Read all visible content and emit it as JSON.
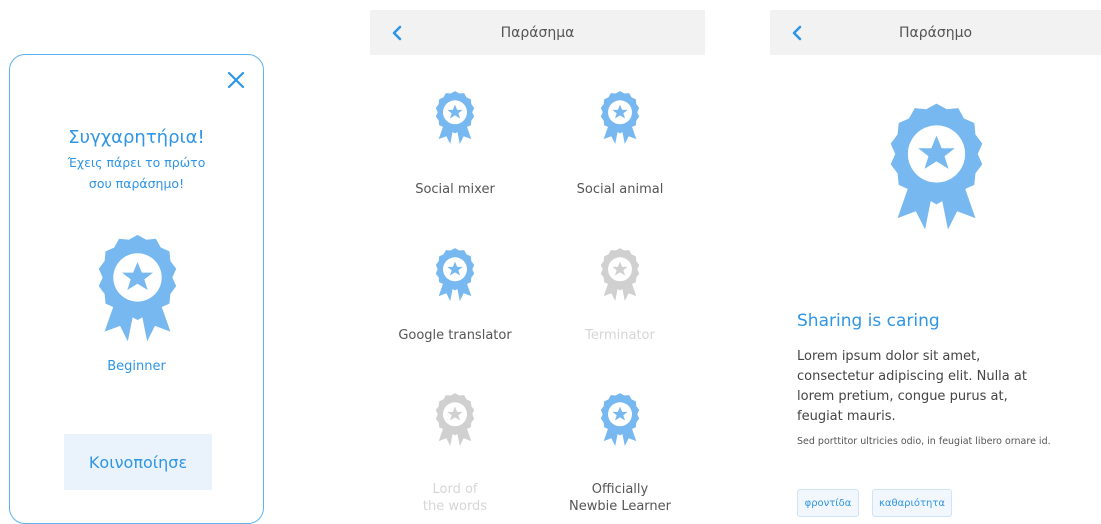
{
  "colors": {
    "accent": "#2f95e5",
    "badge": "#76b8ef",
    "badge_disabled": "#d0d0d0"
  },
  "modal": {
    "close_icon": "close-icon",
    "title": "Συγχαρητήρια!",
    "subtitle_line1": "Έχεις πάρει το πρώτο",
    "subtitle_line2": "σου παράσημο!",
    "badge_label": "Beginner",
    "share_label": "Κοινοποίησε"
  },
  "list": {
    "header_title": "Παράσημα",
    "badges": [
      {
        "label": "Social mixer",
        "enabled": true
      },
      {
        "label": "Social animal",
        "enabled": true
      },
      {
        "label": "Google translator",
        "enabled": true
      },
      {
        "label": "Terminator",
        "enabled": false
      },
      {
        "label_line1": "Lord of",
        "label_line2": "the words",
        "enabled": false
      },
      {
        "label_line1": "Officially",
        "label_line2": "Newbie Learner",
        "enabled": true
      }
    ]
  },
  "detail": {
    "header_title": "Παράσημο",
    "title": "Sharing is caring",
    "body_line1": "Lorem ipsum dolor sit amet,",
    "body_line2": "consectetur adipiscing elit. Nulla at",
    "body_line3": "lorem pretium, congue purus at,",
    "body_line4": "feugiat mauris.",
    "note": "Sed porttitor ultricies odio, in feugiat libero ornare id.",
    "tags": [
      "φροντίδα",
      "καθαριότητα"
    ]
  }
}
